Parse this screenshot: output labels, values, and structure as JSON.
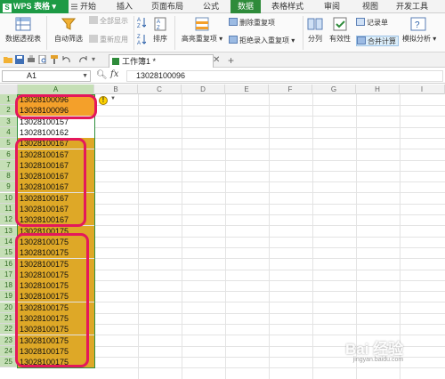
{
  "app": {
    "title": "WPS 表格",
    "brand_color": "#1d9a45"
  },
  "menu_tabs": [
    "开始",
    "插入",
    "页面布局",
    "公式",
    "数据",
    "表格样式",
    "审阅",
    "视图",
    "开发工具"
  ],
  "active_tab": "数据",
  "ribbon": {
    "pivot_table": "数据透视表",
    "auto_filter": "自动筛选",
    "show_all": "全部显示",
    "reapply": "重新应用",
    "sort": "排序",
    "highlight_duplicates": "高亮重复项",
    "remove_duplicates": "删除重复项",
    "reject_duplicates": "拒绝录入重复项",
    "split": "分列",
    "validation": "有效性",
    "record_list": "记录单",
    "consolidate": "合并计算",
    "what_if": "模拟分析"
  },
  "document_tab": {
    "label": "工作簿1 *"
  },
  "formula_bar": {
    "name_box": "A1",
    "fx": "fx",
    "value": "13028100096"
  },
  "columns": [
    "A",
    "B",
    "C",
    "D",
    "E",
    "F",
    "G",
    "H",
    "I"
  ],
  "rows": [
    {
      "row": "1",
      "value": "13028100096"
    },
    {
      "row": "2",
      "value": "13028100096"
    },
    {
      "row": "3",
      "value": "13028100157"
    },
    {
      "row": "4",
      "value": "13028100162"
    },
    {
      "row": "5",
      "value": "13028100167"
    },
    {
      "row": "6",
      "value": "13028100167"
    },
    {
      "row": "7",
      "value": "13028100167"
    },
    {
      "row": "8",
      "value": "13028100167"
    },
    {
      "row": "9",
      "value": "13028100167"
    },
    {
      "row": "10",
      "value": "13028100167"
    },
    {
      "row": "11",
      "value": "13028100167"
    },
    {
      "row": "12",
      "value": "13028100167"
    },
    {
      "row": "13",
      "value": "13028100175"
    },
    {
      "row": "14",
      "value": "13028100175"
    },
    {
      "row": "15",
      "value": "13028100175"
    },
    {
      "row": "16",
      "value": "13028100175"
    },
    {
      "row": "17",
      "value": "13028100175"
    },
    {
      "row": "18",
      "value": "13028100175"
    },
    {
      "row": "19",
      "value": "13028100175"
    },
    {
      "row": "20",
      "value": "13028100175"
    },
    {
      "row": "21",
      "value": "13028100175"
    },
    {
      "row": "22",
      "value": "13028100175"
    },
    {
      "row": "23",
      "value": "13028100175"
    },
    {
      "row": "24",
      "value": "13028100175"
    },
    {
      "row": "25",
      "value": "13028100175"
    }
  ],
  "colors": {
    "duplicate_fill": "#dea827",
    "active_cell_fill": "#f4a02a",
    "callout": "#e4185b",
    "selection": "#2f8f3d"
  },
  "watermark": {
    "text": "Bai 经验",
    "sub": "jingyan.baidu.com"
  }
}
